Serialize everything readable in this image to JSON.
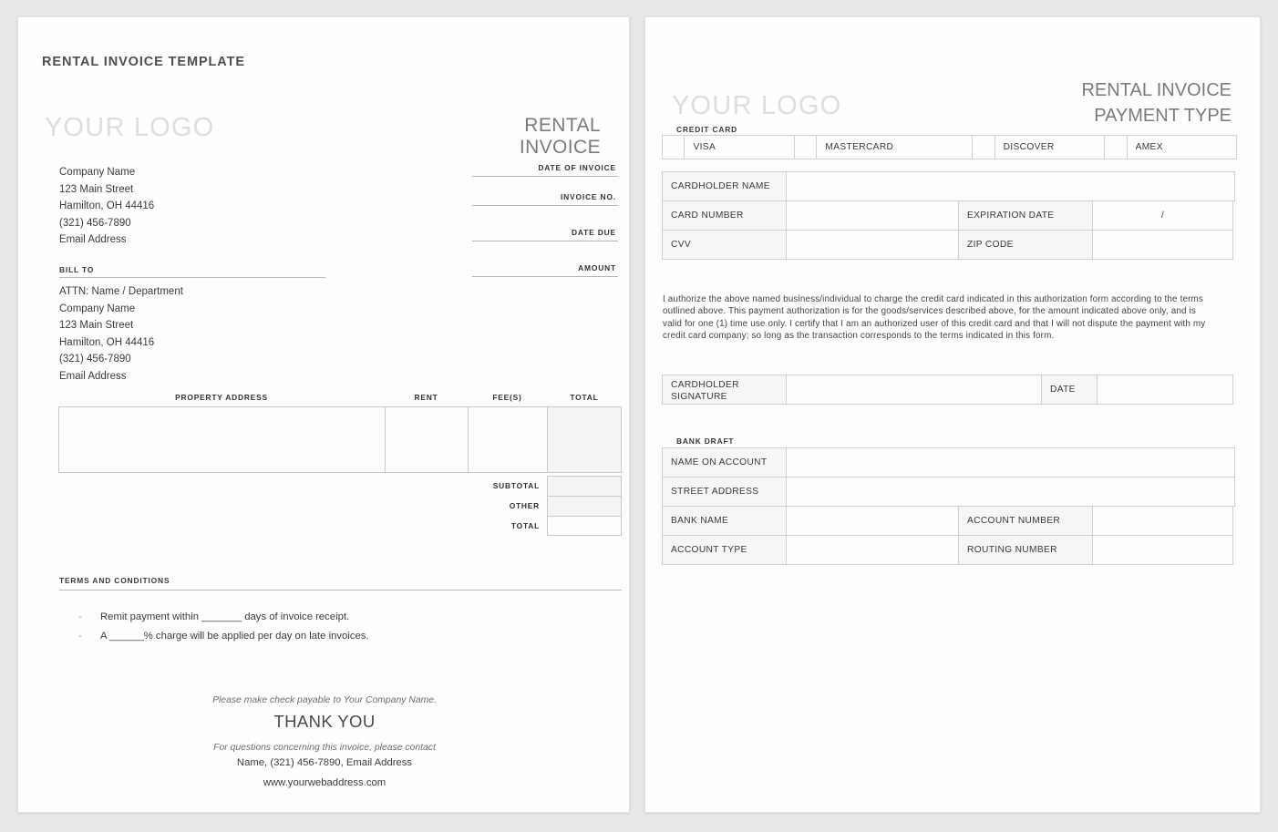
{
  "theme": {
    "backdrop": "#e8e8e8",
    "page_bg": "#fefefe",
    "logo_gray": "#dddddd",
    "rule_gray": "#c9c9c9",
    "tint_gray": "#f4f4f4"
  },
  "page1": {
    "template_title": "RENTAL INVOICE TEMPLATE",
    "logo_placeholder": "YOUR LOGO",
    "doc_type": "RENTAL INVOICE",
    "company": [
      "Company Name",
      "123 Main Street",
      "Hamilton, OH  44416",
      "(321) 456-7890",
      "Email Address"
    ],
    "bill_to_label": "BILL TO",
    "bill_to": [
      "ATTN: Name / Department",
      "Company Name",
      "123 Main Street",
      "Hamilton, OH  44416",
      "(321) 456-7890",
      "Email Address"
    ],
    "invoice_fields": [
      {
        "label": "DATE OF INVOICE",
        "value": ""
      },
      {
        "label": "INVOICE NO.",
        "value": ""
      },
      {
        "label": "DATE DUE",
        "value": ""
      },
      {
        "label": "AMOUNT",
        "value": ""
      }
    ],
    "property_table": {
      "headers": [
        "PROPERTY ADDRESS",
        "RENT",
        "FEE(S)",
        "TOTAL"
      ],
      "rows": [
        [
          "",
          "",
          "",
          ""
        ]
      ]
    },
    "totals": [
      {
        "label": "SUBTOTAL",
        "value": ""
      },
      {
        "label": "OTHER",
        "value": ""
      },
      {
        "label": "TOTAL",
        "value": ""
      }
    ],
    "terms_label": "TERMS AND CONDITIONS",
    "terms": [
      "Remit payment within _______ days of invoice receipt.",
      "A ______% charge will be applied per day on late invoices."
    ],
    "footer": {
      "check_line": "Please make check payable to Your Company Name.",
      "thank_you": "THANK YOU",
      "questions": "For questions concerning this invoice, please contact",
      "contact": "Name, (321) 456-7890, Email Address",
      "website": "www.yourwebaddress.com"
    }
  },
  "page2": {
    "logo_placeholder": "YOUR LOGO",
    "doc_type_line1": "RENTAL INVOICE",
    "doc_type_line2": "PAYMENT TYPE",
    "credit_card_label": "CREDIT CARD",
    "card_types": [
      "VISA",
      "MASTERCARD",
      "DISCOVER",
      "AMEX"
    ],
    "card_fields": {
      "cardholder_name_label": "CARDHOLDER NAME",
      "cardholder_name_value": "",
      "card_number_label": "CARD NUMBER",
      "card_number_value": "",
      "expiration_date_label": "EXPIRATION DATE",
      "expiration_date_value": "/",
      "cvv_label": "CVV",
      "cvv_value": "",
      "zip_code_label": "ZIP CODE",
      "zip_code_value": ""
    },
    "authorization_text": "I authorize the above named business/individual to charge the credit card indicated in this authorization form according to the terms outlined above. This payment authorization is for the goods/services described above, for the amount indicated above only, and is valid for one (1) time use only. I certify that I am an authorized user of this credit card and that I will not dispute the payment with my credit card company; so long as the transaction corresponds to the terms indicated in this form.",
    "signature": {
      "label_line1": "CARDHOLDER",
      "label_line2": "SIGNATURE",
      "value": "",
      "date_label": "DATE",
      "date_value": ""
    },
    "bank_draft_label": "BANK DRAFT",
    "bank_fields": {
      "name_on_account_label": "NAME ON ACCOUNT",
      "name_on_account_value": "",
      "street_address_label": "STREET ADDRESS",
      "street_address_value": "",
      "bank_name_label": "BANK NAME",
      "bank_name_value": "",
      "account_number_label": "ACCOUNT NUMBER",
      "account_number_value": "",
      "account_type_label": "ACCOUNT TYPE",
      "account_type_value": "",
      "routing_number_label": "ROUTING NUMBER",
      "routing_number_value": ""
    }
  }
}
